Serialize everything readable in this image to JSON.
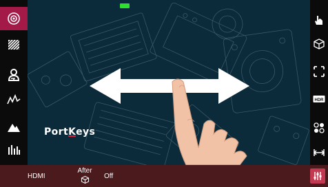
{
  "brand": {
    "prefix": "Port",
    "accent_letter": "K",
    "suffix": "eys"
  },
  "bottom_bar": {
    "output_label": "HDMI",
    "after_label": "After",
    "after_icon": "cube-icon",
    "state_label": "Off"
  },
  "left_sidebar": {
    "items": [
      {
        "icon": "target-icon",
        "active": true
      },
      {
        "icon": "zebra-stripes-icon",
        "active": false
      },
      {
        "icon": "person-focus-icon",
        "active": false
      },
      {
        "icon": "waveform-icon",
        "active": false
      },
      {
        "icon": "mountain-peaking-icon",
        "active": false
      },
      {
        "icon": "histogram-icon",
        "active": false
      }
    ]
  },
  "right_sidebar": {
    "items": [
      {
        "icon": "hand-pointer-icon"
      },
      {
        "icon": "cube-icon"
      },
      {
        "icon": "frame-guides-icon"
      },
      {
        "icon": "hdr-icon",
        "text": "HDR"
      },
      {
        "icon": "dots-grid-icon"
      },
      {
        "icon": "anamorphic-icon"
      },
      {
        "icon": "settings-sliders-icon",
        "active": true
      }
    ]
  },
  "colors": {
    "active_left": "#a31a48",
    "bottom_bar": "#4a1a1d",
    "settings_active": "#c23a52",
    "indicator": "#2ee02e"
  }
}
